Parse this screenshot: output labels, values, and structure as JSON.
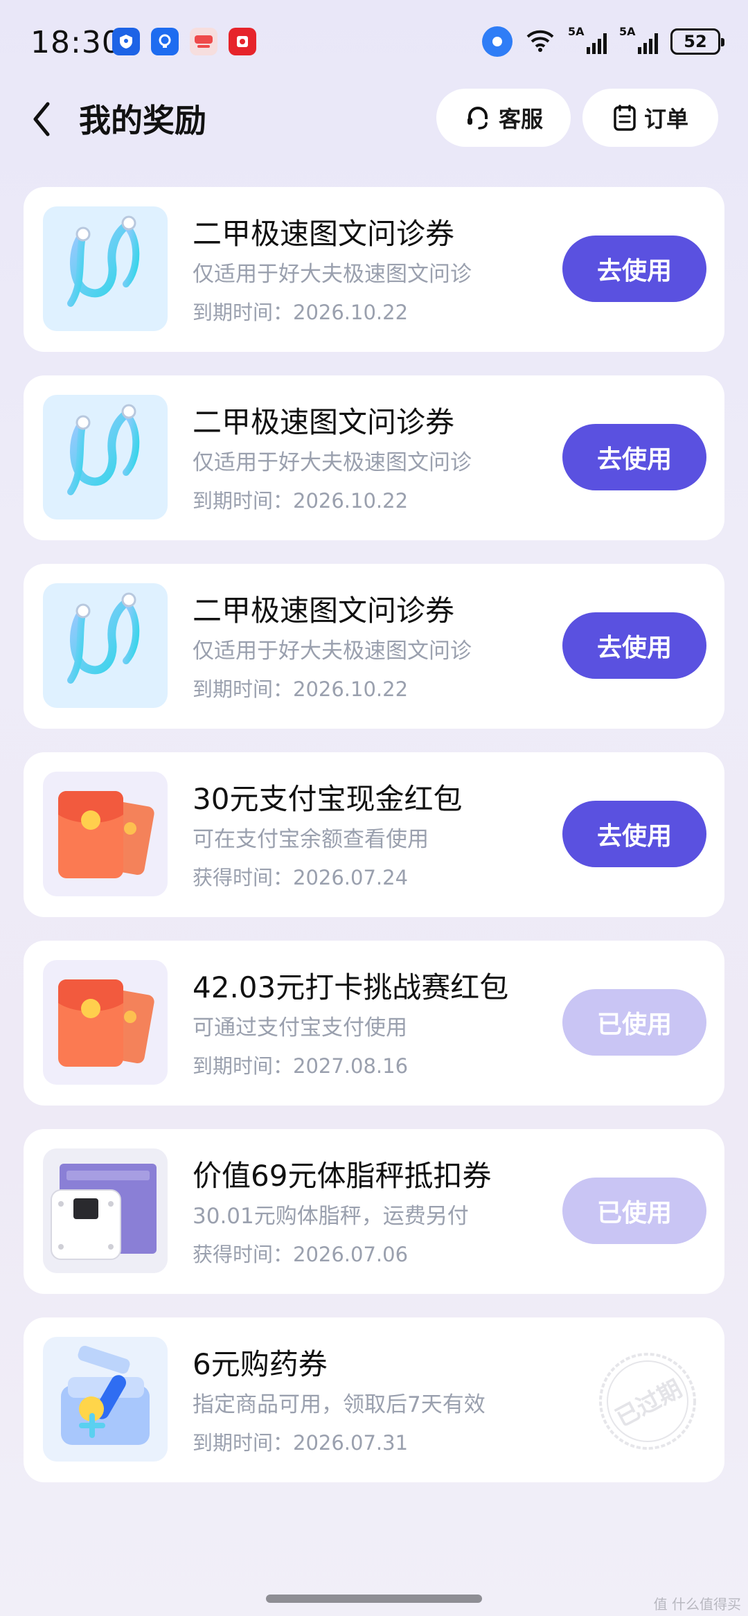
{
  "status_bar": {
    "time": "18:30",
    "app_icons": [
      {
        "name": "security-app-icon",
        "color": "#1d63e6"
      },
      {
        "name": "bulb-app-icon",
        "color": "#1e6cf0"
      },
      {
        "name": "oppo-store-app-icon",
        "color": "#ee4a4a"
      },
      {
        "name": "video-app-icon",
        "color": "#e6242b"
      }
    ],
    "signal_1": "5A",
    "signal_2": "5A",
    "battery": "52"
  },
  "header": {
    "title": "我的奖励",
    "service_label": "客服",
    "orders_label": "订单"
  },
  "colors": {
    "accent": "#5a51e0",
    "used": "#c9c5f4",
    "muted_text": "#9aa0ae"
  },
  "rewards": [
    {
      "title": "二甲极速图文问诊券",
      "desc": "仅适用于好大夫极速图文问诊",
      "date": "到期时间：2026.10.22",
      "button": "去使用",
      "state": "active",
      "icon": "stethoscope-icon"
    },
    {
      "title": "二甲极速图文问诊券",
      "desc": "仅适用于好大夫极速图文问诊",
      "date": "到期时间：2026.10.22",
      "button": "去使用",
      "state": "active",
      "icon": "stethoscope-icon"
    },
    {
      "title": "二甲极速图文问诊券",
      "desc": "仅适用于好大夫极速图文问诊",
      "date": "到期时间：2026.10.22",
      "button": "去使用",
      "state": "active",
      "icon": "stethoscope-icon"
    },
    {
      "title": "30元支付宝现金红包",
      "desc": "可在支付宝余额查看使用",
      "date": "获得时间：2026.07.24",
      "button": "去使用",
      "state": "active",
      "icon": "red-envelope-icon"
    },
    {
      "title": "42.03元打卡挑战赛红包",
      "desc": "可通过支付宝支付使用",
      "date": "到期时间：2027.08.16",
      "button": "已使用",
      "state": "used",
      "icon": "red-envelope-icon"
    },
    {
      "title": "价值69元体脂秤抵扣券",
      "desc": "30.01元购体脂秤，运费另付",
      "date": "获得时间：2026.07.06",
      "button": "已使用",
      "state": "used",
      "icon": "body-fat-scale-icon"
    },
    {
      "title": "6元购药券",
      "desc": "指定商品可用，领取后7天有效",
      "date": "到期时间：2026.07.31",
      "button": "已过期",
      "state": "expired",
      "icon": "medicine-box-icon"
    }
  ],
  "watermark": "值 什么值得买"
}
